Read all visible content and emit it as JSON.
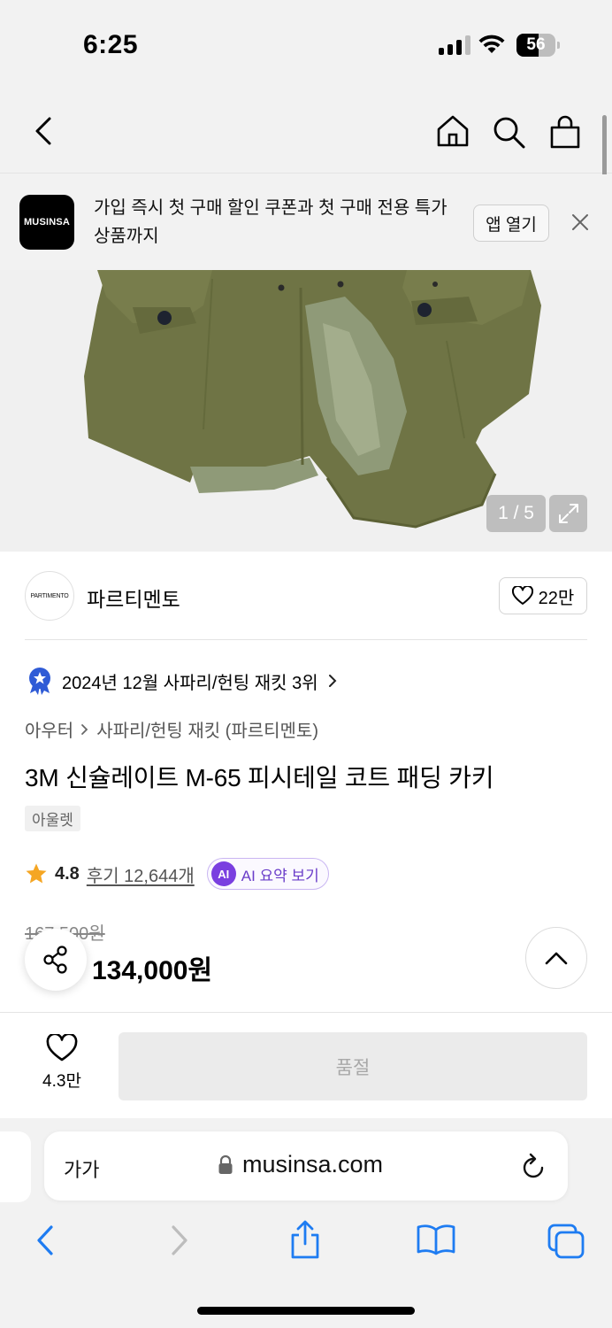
{
  "status_bar": {
    "time": "6:25",
    "battery": "56",
    "battery_level": 0.56
  },
  "banner": {
    "logo_text": "MUSINSA",
    "text": "가입 즉시 첫 구매 할인 쿠폰과 첫 구매 전용 특가 상품까지",
    "open_button": "앱 열기"
  },
  "gallery": {
    "counter": "1 / 5"
  },
  "brand": {
    "logo_text": "PARTIMENTO",
    "name": "파르티멘토",
    "likes": "22만"
  },
  "rank": {
    "text": "2024년 12월 사파리/헌팅 재킷 3위"
  },
  "breadcrumb": {
    "category": "아우터",
    "subcategory": "사파리/헌팅 재킷 (파르티멘토)"
  },
  "product": {
    "title": "3M 신슐레이트 M-65 피시테일 코트 패딩 카키",
    "tag": "아울렛",
    "rating": "4.8",
    "reviews": "후기 12,644개",
    "ai_label": "AI",
    "ai_button": "AI 요약 보기",
    "original_price": "167,500원",
    "sale_price": "134,000원"
  },
  "action_bar": {
    "wish_count": "4.3만",
    "buy_button": "품절"
  },
  "browser": {
    "aa": "가가",
    "url": "musinsa.com"
  },
  "colors": {
    "accent_purple": "#6a3dc9",
    "rank_badge": "#2f5bd6",
    "star": "#f5a623",
    "ios_blue": "#1e7cf2"
  }
}
